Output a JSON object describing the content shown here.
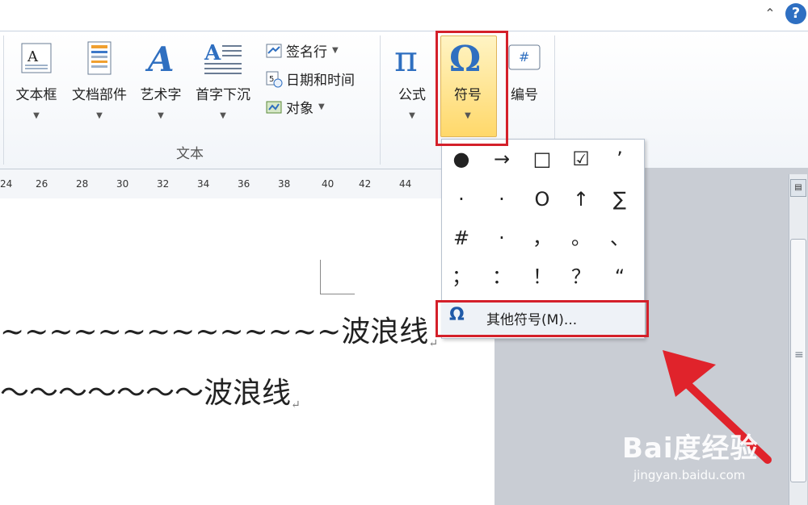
{
  "ribbon": {
    "text_box": "文本框",
    "quick_parts": "文档部件",
    "word_art": "艺术字",
    "drop_cap": "首字下沉",
    "signature_line": "签名行",
    "date_time": "日期和时间",
    "object": "对象",
    "group_text_label": "文本",
    "equation": "公式",
    "symbol": "符号",
    "number": "编号"
  },
  "ruler_ticks": [
    "24",
    "26",
    "28",
    "30",
    "32",
    "34",
    "36",
    "38",
    "40",
    "42",
    "44"
  ],
  "document": {
    "line1_text": "~~~~~~~~~~~~~~波浪线",
    "line2_text": "～～～～～～～波浪线",
    "para_mark": "↵"
  },
  "symbol_dropdown": {
    "symbols": [
      "●",
      "→",
      "□",
      "☑",
      "’",
      "·",
      "·",
      "O",
      "↑",
      "∑",
      "#",
      "·",
      "，",
      "。",
      "、",
      "；",
      "：",
      "！",
      "？",
      "“"
    ],
    "more_symbols_label": "其他符号(M)..."
  },
  "watermark": {
    "main": "Bai度经验",
    "sub": "jingyan.baidu.com"
  },
  "colors": {
    "highlight_red": "#d4202a",
    "symbol_button_fill": "#ffd86a",
    "help_blue": "#2e6fc2"
  }
}
